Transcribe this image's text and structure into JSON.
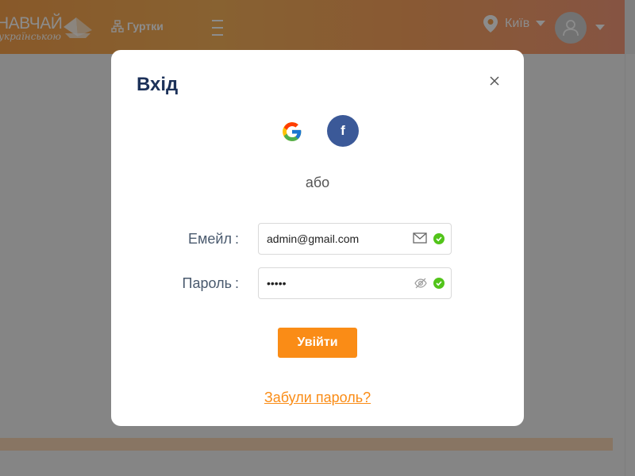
{
  "header": {
    "logo_main": "НАВЧАЙ",
    "logo_sub": "українською",
    "nav_clubs_label": "Гуртки",
    "city": "Київ"
  },
  "modal": {
    "title": "Вхід",
    "or_text": "або",
    "email_label": "Емейл",
    "email_value": "admin@gmail.com",
    "password_label": "Пароль",
    "password_value": "•••••",
    "login_button": "Увійти",
    "forgot_link": "Забули пароль?",
    "facebook_letter": "f"
  },
  "colors": {
    "accent": "#fa8c16",
    "title": "#1c3159",
    "facebook": "#3b5998",
    "success": "#52c41a"
  },
  "icons": [
    "map-pin-icon",
    "chevron-down-icon",
    "user-icon",
    "network-icon",
    "menu-icon",
    "close-icon",
    "google-icon",
    "facebook-icon",
    "mail-icon",
    "eye-off-icon",
    "check-circle-icon"
  ]
}
